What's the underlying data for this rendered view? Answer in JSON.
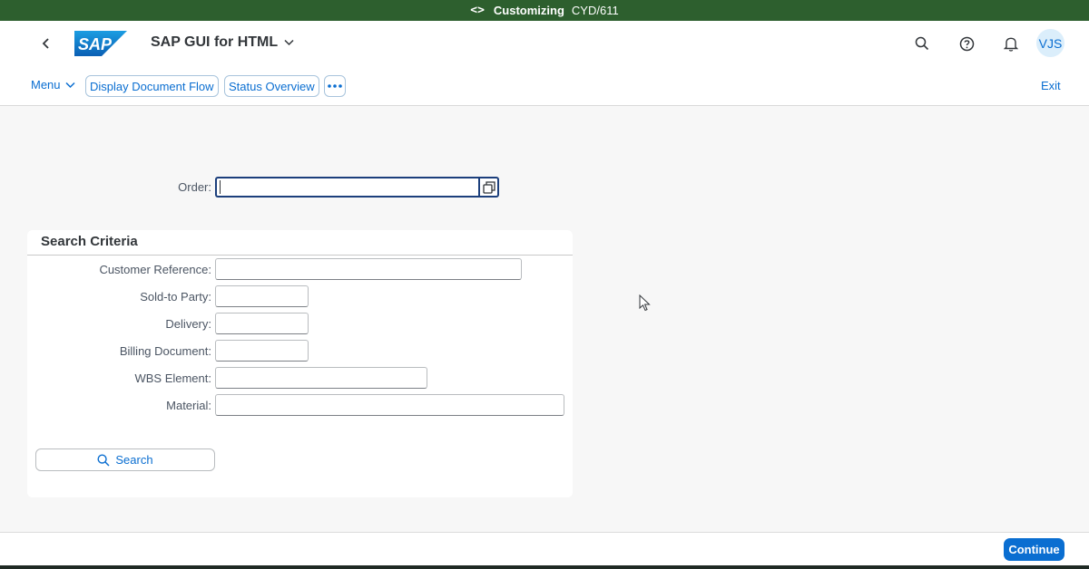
{
  "topbar": {
    "transaction": "Customizing",
    "system": "CYD/611",
    "code_icon": "<>"
  },
  "shellbar": {
    "logo_text": "SAP",
    "app_title": "SAP GUI for HTML",
    "avatar_initials": "VJS"
  },
  "toolbar": {
    "menu_label": "Menu",
    "buttons": [
      "Display Document Flow",
      "Status Overview"
    ],
    "exit_label": "Exit"
  },
  "order": {
    "label": "Order:",
    "value": ""
  },
  "search_criteria": {
    "title": "Search Criteria",
    "fields": [
      {
        "label": "Customer Reference:",
        "value": ""
      },
      {
        "label": "Sold-to Party:",
        "value": ""
      },
      {
        "label": "Delivery:",
        "value": ""
      },
      {
        "label": "Billing Document:",
        "value": ""
      },
      {
        "label": "WBS Element:",
        "value": ""
      },
      {
        "label": "Material:",
        "value": ""
      }
    ],
    "search_label": "Search"
  },
  "footer": {
    "continue_label": "Continue"
  },
  "colors": {
    "header_green": "#2d5f2e",
    "brand_blue": "#0a6ed1",
    "focus_blue": "#1c3f7c"
  }
}
